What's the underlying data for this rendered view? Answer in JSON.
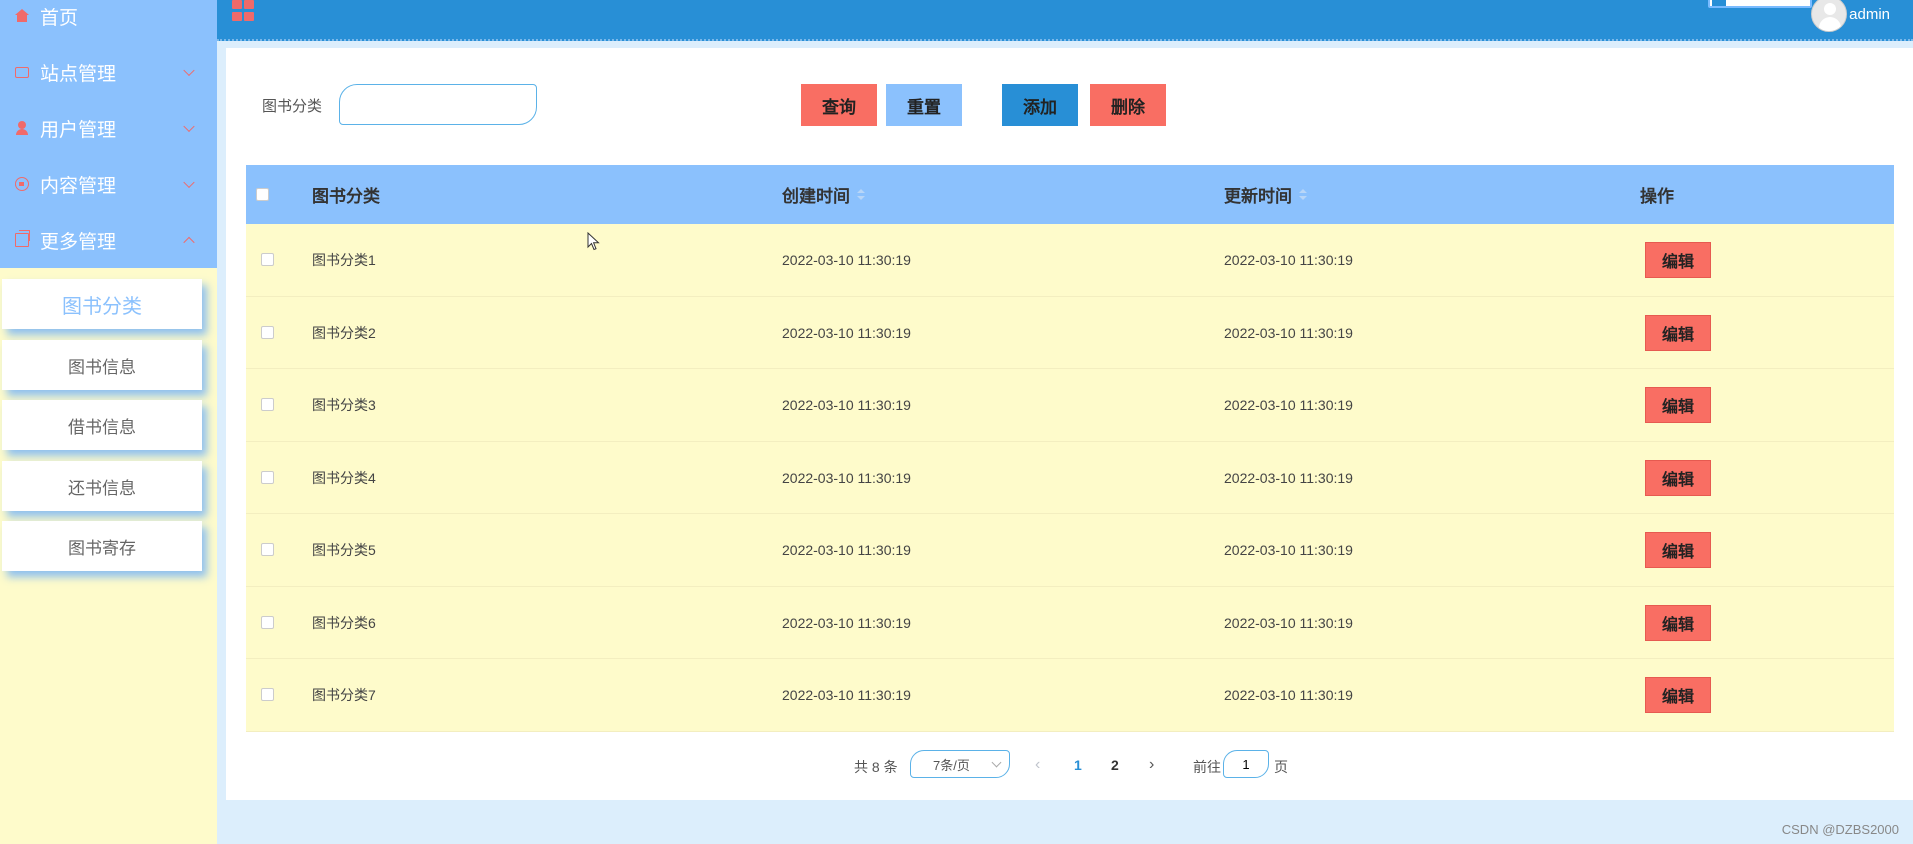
{
  "sidebar": {
    "menu": [
      {
        "label": "首页",
        "icon": "home-icon"
      },
      {
        "label": "站点管理",
        "icon": "monitor-icon"
      },
      {
        "label": "用户管理",
        "icon": "user-icon"
      },
      {
        "label": "内容管理",
        "icon": "chat-icon"
      },
      {
        "label": "更多管理",
        "icon": "copy-icon"
      }
    ],
    "submenu": [
      {
        "label": "图书分类",
        "active": true
      },
      {
        "label": "图书信息"
      },
      {
        "label": "借书信息"
      },
      {
        "label": "还书信息"
      },
      {
        "label": "图书寄存"
      }
    ]
  },
  "header": {
    "user": "admin"
  },
  "search": {
    "label": "图书分类",
    "value": ""
  },
  "toolbar": {
    "query_label": "查询",
    "reset_label": "重置",
    "add_label": "添加",
    "delete_label": "删除"
  },
  "table": {
    "columns": [
      "图书分类",
      "创建时间",
      "更新时间",
      "操作"
    ],
    "rows": [
      {
        "category": "图书分类1",
        "created": "2022-03-10 11:30:19",
        "updated": "2022-03-10 11:30:19",
        "action": "编辑"
      },
      {
        "category": "图书分类2",
        "created": "2022-03-10 11:30:19",
        "updated": "2022-03-10 11:30:19",
        "action": "编辑"
      },
      {
        "category": "图书分类3",
        "created": "2022-03-10 11:30:19",
        "updated": "2022-03-10 11:30:19",
        "action": "编辑"
      },
      {
        "category": "图书分类4",
        "created": "2022-03-10 11:30:19",
        "updated": "2022-03-10 11:30:19",
        "action": "编辑"
      },
      {
        "category": "图书分类5",
        "created": "2022-03-10 11:30:19",
        "updated": "2022-03-10 11:30:19",
        "action": "编辑"
      },
      {
        "category": "图书分类6",
        "created": "2022-03-10 11:30:19",
        "updated": "2022-03-10 11:30:19",
        "action": "编辑"
      },
      {
        "category": "图书分类7",
        "created": "2022-03-10 11:30:19",
        "updated": "2022-03-10 11:30:19",
        "action": "编辑"
      }
    ]
  },
  "pagination": {
    "total_text": "共 8 条",
    "page_size": "7条/页",
    "pages": [
      "1",
      "2"
    ],
    "current_page": "1",
    "goto_label": "前往",
    "goto_value": "1",
    "goto_suffix": "页"
  },
  "watermark": "CSDN @DZBS2000",
  "colors": {
    "header": "#288fd6",
    "sidebar_top": "#8bc1fd",
    "sidebar_bottom": "#fefbcb",
    "accent_red": "#f96e63",
    "row_bg": "#fefbcb"
  }
}
